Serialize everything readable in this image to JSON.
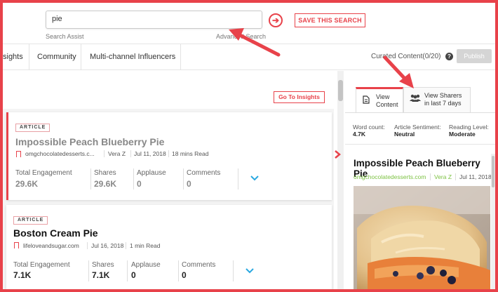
{
  "search": {
    "value": "pie",
    "assist_label": "Search Assist",
    "advanced_label": "Advanced Search",
    "go_glyph": "➔",
    "save_label": "SAVE THIS SEARCH"
  },
  "nav": {
    "items": [
      {
        "label": "sights"
      },
      {
        "label": "Community"
      },
      {
        "label": "Multi-channel Influencers"
      }
    ],
    "curated_label": "Curated Content(0/20)",
    "help_glyph": "?",
    "publish_label": "Publish"
  },
  "left": {
    "goto_insights_label": "Go To Insights",
    "cards": [
      {
        "badge": "ARTICLE",
        "title": "Impossible Peach Blueberry Pie",
        "site": "omgchocolatedesserts.c...",
        "author": "Vera Z",
        "date": "Jul 11, 2018",
        "read_time": "18 mins Read",
        "stats": [
          {
            "label": "Total Engagement",
            "value": "29.6K"
          },
          {
            "label": "Shares",
            "value": "29.6K"
          },
          {
            "label": "Applause",
            "value": "0"
          },
          {
            "label": "Comments",
            "value": "0"
          }
        ]
      },
      {
        "badge": "ARTICLE",
        "title": "Boston Cream Pie",
        "site": "lifeloveandsugar.com",
        "date": "Jul 16, 2018",
        "read_time": "1 min Read",
        "stats": [
          {
            "label": "Total Engagement",
            "value": "7.1K"
          },
          {
            "label": "Shares",
            "value": "7.1K"
          },
          {
            "label": "Applause",
            "value": "0"
          },
          {
            "label": "Comments",
            "value": "0"
          }
        ]
      }
    ]
  },
  "right": {
    "tabs": [
      {
        "line1": "View",
        "line2": "Content"
      },
      {
        "line1": "View Sharers",
        "line2": "in last 7 days"
      }
    ],
    "stats": [
      {
        "label": "Word count:",
        "value": "4.7K"
      },
      {
        "label": "Article Sentiment:",
        "value": "Neutral"
      },
      {
        "label": "Reading Level:",
        "value": "Moderate"
      }
    ],
    "title": "Impossible Peach Blueberry Pie",
    "site": "omgchocolatedesserts.com",
    "author": "Vera Z",
    "date": "Jul 11, 2018"
  },
  "colors": {
    "accent": "#e8424a",
    "link_blue": "#29a8e0",
    "site_green": "#7dc243"
  }
}
